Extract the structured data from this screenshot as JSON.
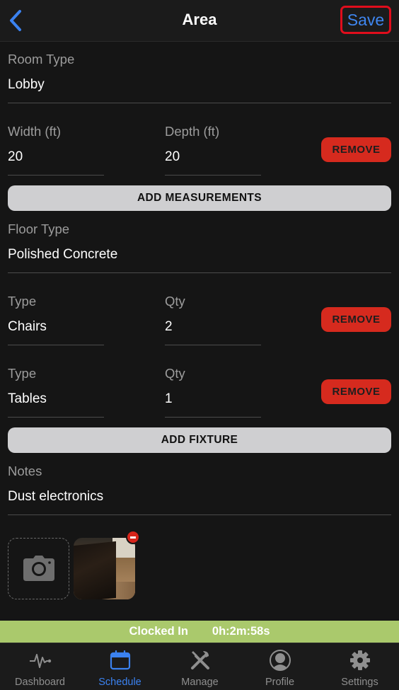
{
  "nav": {
    "title": "Area",
    "save_label": "Save",
    "back_icon": "chevron-left-icon"
  },
  "room": {
    "label": "Room Type",
    "value": "Lobby"
  },
  "measurement": {
    "width_label": "Width (ft)",
    "width_value": "20",
    "depth_label": "Depth (ft)",
    "depth_value": "20",
    "remove_label": "REMOVE"
  },
  "add_measurements_label": "ADD MEASUREMENTS",
  "floor": {
    "label": "Floor Type",
    "value": "Polished Concrete"
  },
  "fixtures": [
    {
      "type_label": "Type",
      "type_value": "Chairs",
      "qty_label": "Qty",
      "qty_value": "2",
      "remove_label": "REMOVE"
    },
    {
      "type_label": "Type",
      "type_value": "Tables",
      "qty_label": "Qty",
      "qty_value": "1",
      "remove_label": "REMOVE"
    }
  ],
  "add_fixture_label": "ADD FIXTURE",
  "notes": {
    "label": "Notes",
    "value": "Dust electronics"
  },
  "photos": {
    "add_icon": "camera-icon",
    "remove_icon": "minus-circle-icon"
  },
  "status": {
    "label": "Clocked In",
    "timer": "0h:2m:58s",
    "color": "#aac96c"
  },
  "tabs": [
    {
      "label": "Dashboard",
      "icon": "pulse-icon",
      "active": false
    },
    {
      "label": "Schedule",
      "icon": "calendar-icon",
      "active": true
    },
    {
      "label": "Manage",
      "icon": "tools-icon",
      "active": false
    },
    {
      "label": "Profile",
      "icon": "person-circle-icon",
      "active": false
    },
    {
      "label": "Settings",
      "icon": "gear-icon",
      "active": false
    }
  ],
  "colors": {
    "accent": "#3b82f0",
    "danger": "#d62a1e",
    "highlight_border": "#e00d1c",
    "background": "#151515"
  }
}
